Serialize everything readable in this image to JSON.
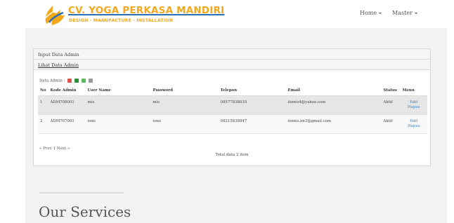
{
  "brand": {
    "title": "CV. YOGA PERKASA MANDIRI",
    "subtitle": "DESIGN - MANUFACTURE - INSTALLATION",
    "colors": {
      "orange": "#f3a81c",
      "blue": "#2a6fb8"
    }
  },
  "nav": [
    {
      "label": "Home"
    },
    {
      "label": "Master"
    }
  ],
  "panel": {
    "title": "Input Data Admin",
    "subtitle": "Lihat Data Admin",
    "section_label": "Data Admin",
    "export_icons": [
      "pdf-icon",
      "excel-icon",
      "spreadsheet-icon",
      "print-icon"
    ]
  },
  "table": {
    "columns": [
      "No",
      "Kode Admin",
      "User Name",
      "Password",
      "Telepon",
      "Email",
      "Status",
      "Menu"
    ],
    "rows": [
      {
        "no": "1",
        "kode": "ADM708001",
        "username": "mis",
        "password": "mis",
        "telepon": "08577838035",
        "email": "iismis4@yahoo.com",
        "status": "Aktif",
        "edit": "Edit",
        "hapus": "Hapus"
      },
      {
        "no": "2",
        "kode": "ADM707001",
        "username": "ismi",
        "password": "ismi",
        "telepon": "08215838847",
        "email": "iismis.im3@gmail.com",
        "status": "Aktif",
        "edit": "Edit",
        "hapus": "Hapus"
      }
    ]
  },
  "pager": {
    "prev": "« Prev",
    "page": "1",
    "next": "Next »"
  },
  "total": "Total data 2 item",
  "services_heading": "Our Services"
}
